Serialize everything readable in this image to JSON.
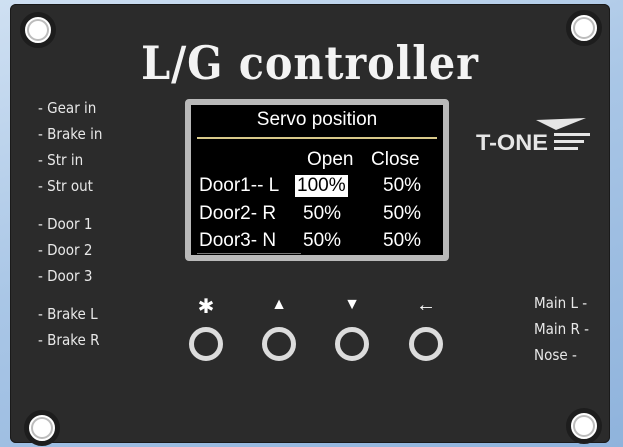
{
  "title": "L/G controller",
  "left_labels": [
    "- Gear in",
    "- Brake in",
    "- Str in",
    "- Str out",
    "- Door 1",
    "- Door 2",
    "- Door 3",
    "- Brake L",
    "- Brake R"
  ],
  "right_labels": [
    "Main L -",
    "Main R -",
    "Nose -"
  ],
  "screen": {
    "title": "Servo position",
    "col_open": "Open",
    "col_close": "Close",
    "rows": [
      {
        "label": "Door1-- L",
        "open": "100%",
        "close": "50%"
      },
      {
        "label": "Door2- R",
        "open": "50%",
        "close": "50%"
      },
      {
        "label": "Door3- N",
        "open": "50%",
        "close": "50%"
      }
    ]
  },
  "logo": {
    "text": "T-ONE"
  },
  "buttons": [
    {
      "icon": "gear-icon",
      "glyph": "✱"
    },
    {
      "icon": "up-arrow-icon",
      "glyph": "▲"
    },
    {
      "icon": "down-arrow-icon",
      "glyph": "▼"
    },
    {
      "icon": "back-arrow-icon",
      "glyph": "←"
    }
  ],
  "colors": {
    "panel": "#2b2b2b",
    "screen": "#000000",
    "text": "#ffffff",
    "background": "#a9c6e6"
  }
}
